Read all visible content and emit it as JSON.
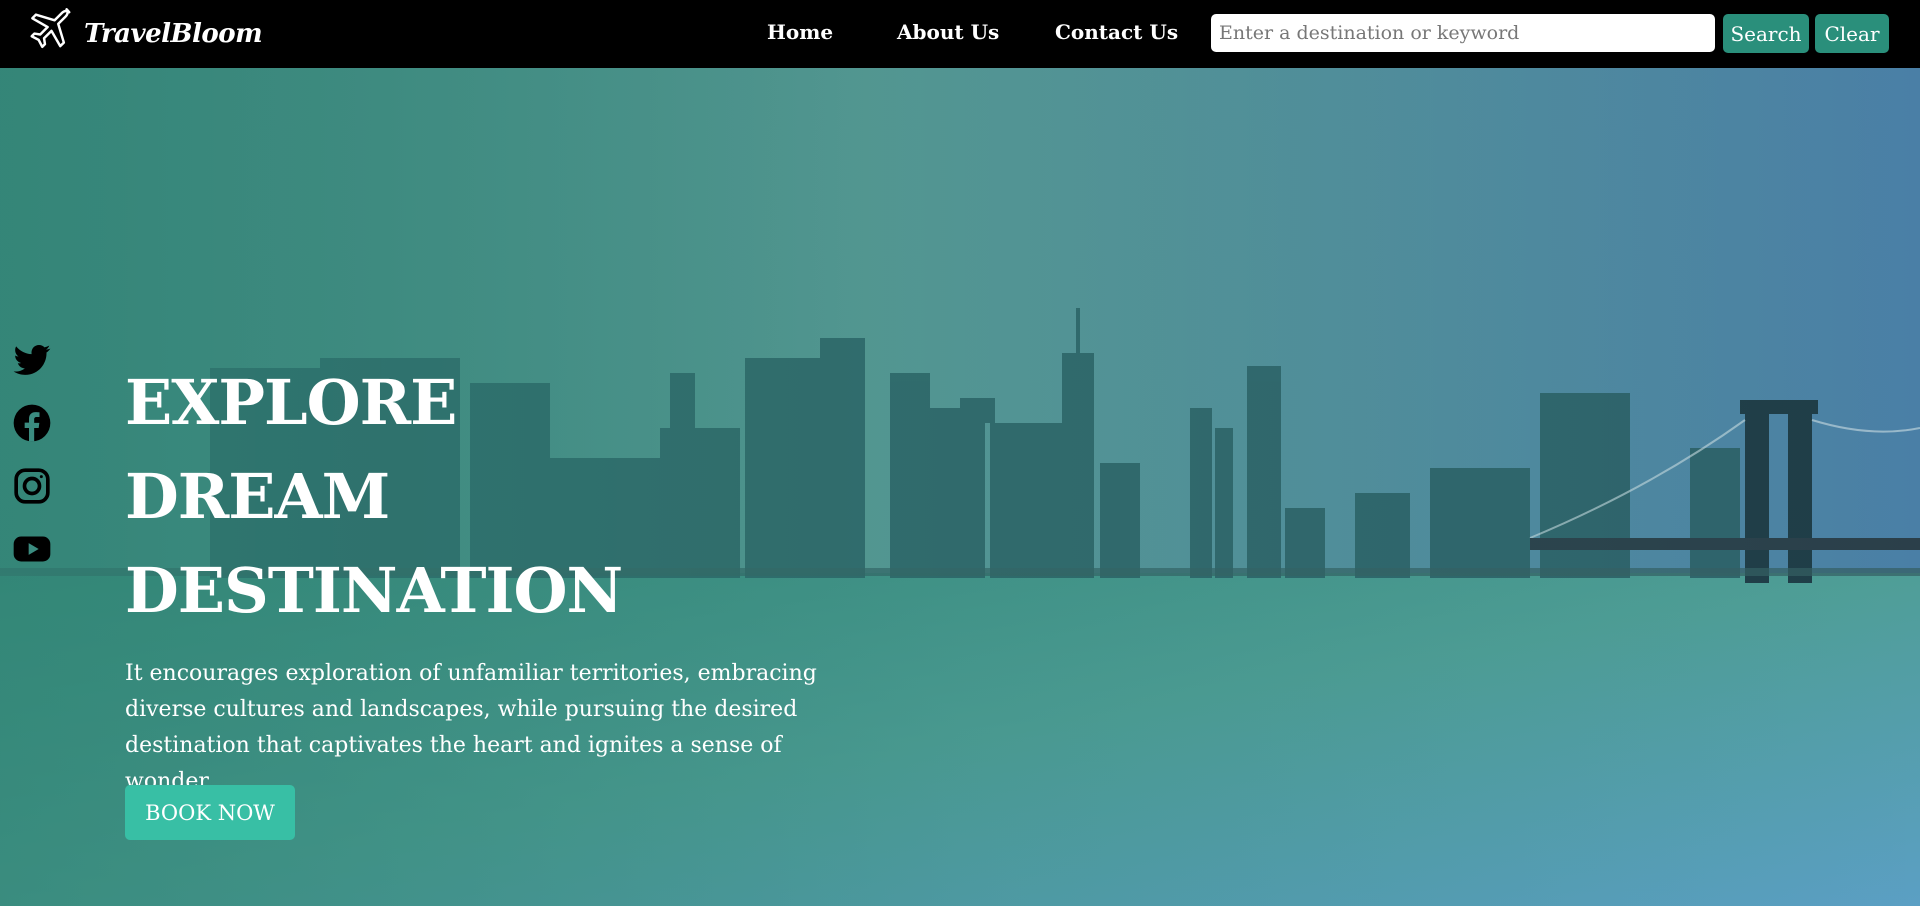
{
  "brand": {
    "name": "TravelBloom",
    "icon": "airplane-icon"
  },
  "nav": {
    "links": [
      {
        "label": "Home"
      },
      {
        "label": "About Us"
      },
      {
        "label": "Contact Us"
      }
    ]
  },
  "search": {
    "placeholder": "Enter a destination or keyword",
    "value": "",
    "search_label": "Search",
    "clear_label": "Clear"
  },
  "social": [
    {
      "icon": "twitter-icon"
    },
    {
      "icon": "facebook-icon"
    },
    {
      "icon": "instagram-icon"
    },
    {
      "icon": "youtube-icon"
    }
  ],
  "hero": {
    "title_lines": [
      "EXPLORE",
      "DREAM",
      "DESTINATION"
    ],
    "text": "It encourages exploration of unfamiliar territories, embracing diverse cultures and landscapes, while pursuing the desired destination that captivates the heart and ignites a sense of wonder.",
    "cta_label": "BOOK NOW"
  },
  "colors": {
    "navbar": "#000000",
    "button": "#2a8f7b",
    "cta": "#38bfa5",
    "overlay": "#2f8f80"
  }
}
